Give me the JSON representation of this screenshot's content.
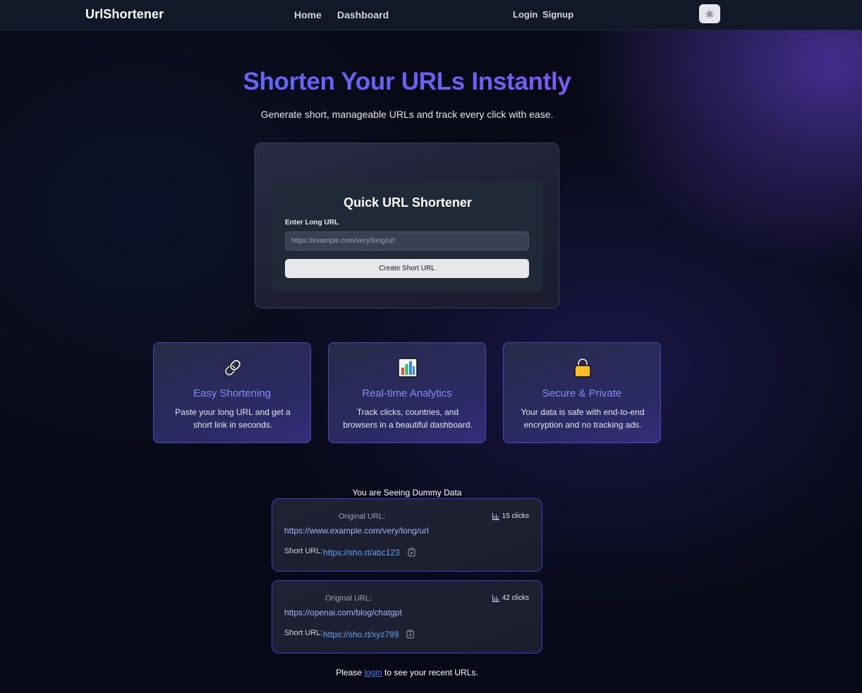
{
  "nav": {
    "brand": "UrlShortener",
    "links": [
      "Home",
      "Dashboard"
    ],
    "auth": [
      "Login",
      "Signup"
    ],
    "theme_icon": "sun-icon"
  },
  "hero": {
    "title": "Shorten Your URLs Instantly",
    "subtitle": "Generate short, manageable URLs and track every click with ease."
  },
  "shortener": {
    "title": "Quick URL Shortener",
    "field_label": "Enter Long URL",
    "placeholder": "https://example.com/very/long/url",
    "value": "",
    "button": "Create Short URL"
  },
  "features": [
    {
      "icon": "chain-link-icon",
      "title": "Easy Shortening",
      "description": "Paste your long URL and get a short link in seconds."
    },
    {
      "icon": "bar-chart-icon",
      "title": "Real-time Analytics",
      "description": "Track clicks, countries, and browsers in a beautiful dashboard."
    },
    {
      "icon": "padlock-icon",
      "title": "Secure & Private",
      "description": "Your data is safe with end-to-end encryption and no tracking ads."
    }
  ],
  "dummy": {
    "note": "You are Seeing Dummy Data",
    "items": [
      {
        "original_label": "Original URL:",
        "original": "https://www.example.com/very/long/url",
        "short_label": "Short URL:",
        "short": "https://sho.rt/abc123",
        "clicks": "15 clicks"
      },
      {
        "original_label": "Original URL:",
        "original": "https://openai.com/blog/chatgpt",
        "short_label": "Short URL:",
        "short": "https://sho.rt/xyz789",
        "clicks": "42 clicks"
      }
    ]
  },
  "footer": {
    "before": "Please ",
    "link": "login",
    "after": " to see your recent URLs."
  },
  "colors": {
    "accent": "#818cf8",
    "link": "#60a5fa",
    "card_border": "#4338ca"
  }
}
